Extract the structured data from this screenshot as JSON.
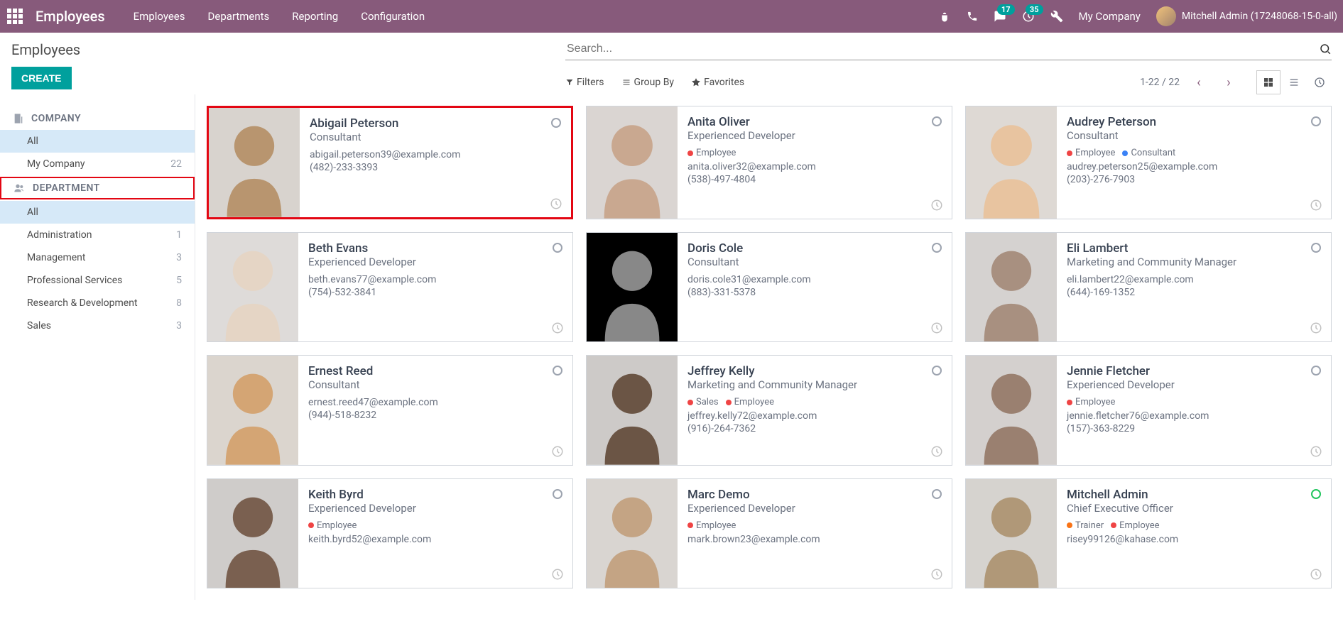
{
  "nav": {
    "brand": "Employees",
    "menu": [
      "Employees",
      "Departments",
      "Reporting",
      "Configuration"
    ],
    "messaging_badge": "17",
    "activity_badge": "35",
    "company": "My Company",
    "user": "Mitchell Admin (17248068-15-0-all)"
  },
  "header": {
    "title": "Employees",
    "create": "CREATE",
    "search_placeholder": "Search...",
    "filters": "Filters",
    "groupby": "Group By",
    "favorites": "Favorites",
    "pager": "1-22 / 22"
  },
  "sidebar": {
    "company_header": "COMPANY",
    "company_items": [
      {
        "label": "All",
        "count": "",
        "active": true
      },
      {
        "label": "My Company",
        "count": "22",
        "active": false
      }
    ],
    "dept_header": "DEPARTMENT",
    "dept_items": [
      {
        "label": "All",
        "count": "",
        "active": true
      },
      {
        "label": "Administration",
        "count": "1",
        "active": false
      },
      {
        "label": "Management",
        "count": "3",
        "active": false
      },
      {
        "label": "Professional Services",
        "count": "5",
        "active": false
      },
      {
        "label": "Research & Development",
        "count": "8",
        "active": false
      },
      {
        "label": "Sales",
        "count": "3",
        "active": false
      }
    ]
  },
  "employees": [
    {
      "name": "Abigail Peterson",
      "title": "Consultant",
      "tags": [],
      "email": "abigail.peterson39@example.com",
      "phone": "(482)-233-3393",
      "highlight": true,
      "status": ""
    },
    {
      "name": "Anita Oliver",
      "title": "Experienced Developer",
      "tags": [
        {
          "c": "red",
          "t": "Employee"
        }
      ],
      "email": "anita.oliver32@example.com",
      "phone": "(538)-497-4804",
      "highlight": false,
      "status": ""
    },
    {
      "name": "Audrey Peterson",
      "title": "Consultant",
      "tags": [
        {
          "c": "red",
          "t": "Employee"
        },
        {
          "c": "blue",
          "t": "Consultant"
        }
      ],
      "email": "audrey.peterson25@example.com",
      "phone": "(203)-276-7903",
      "highlight": false,
      "status": ""
    },
    {
      "name": "Beth Evans",
      "title": "Experienced Developer",
      "tags": [],
      "email": "beth.evans77@example.com",
      "phone": "(754)-532-3841",
      "highlight": false,
      "status": ""
    },
    {
      "name": "Doris Cole",
      "title": "Consultant",
      "tags": [],
      "email": "doris.cole31@example.com",
      "phone": "(883)-331-5378",
      "highlight": false,
      "status": ""
    },
    {
      "name": "Eli Lambert",
      "title": "Marketing and Community Manager",
      "tags": [],
      "email": "eli.lambert22@example.com",
      "phone": "(644)-169-1352",
      "highlight": false,
      "status": ""
    },
    {
      "name": "Ernest Reed",
      "title": "Consultant",
      "tags": [],
      "email": "ernest.reed47@example.com",
      "phone": "(944)-518-8232",
      "highlight": false,
      "status": ""
    },
    {
      "name": "Jeffrey Kelly",
      "title": "Marketing and Community Manager",
      "tags": [
        {
          "c": "red",
          "t": "Sales"
        },
        {
          "c": "red",
          "t": "Employee"
        }
      ],
      "email": "jeffrey.kelly72@example.com",
      "phone": "(916)-264-7362",
      "highlight": false,
      "status": ""
    },
    {
      "name": "Jennie Fletcher",
      "title": "Experienced Developer",
      "tags": [
        {
          "c": "red",
          "t": "Employee"
        }
      ],
      "email": "jennie.fletcher76@example.com",
      "phone": "(157)-363-8229",
      "highlight": false,
      "status": ""
    },
    {
      "name": "Keith Byrd",
      "title": "Experienced Developer",
      "tags": [
        {
          "c": "red",
          "t": "Employee"
        }
      ],
      "email": "keith.byrd52@example.com",
      "phone": "",
      "highlight": false,
      "status": ""
    },
    {
      "name": "Marc Demo",
      "title": "Experienced Developer",
      "tags": [
        {
          "c": "red",
          "t": "Employee"
        }
      ],
      "email": "mark.brown23@example.com",
      "phone": "",
      "highlight": false,
      "status": ""
    },
    {
      "name": "Mitchell Admin",
      "title": "Chief Executive Officer",
      "tags": [
        {
          "c": "orange",
          "t": "Trainer"
        },
        {
          "c": "red",
          "t": "Employee"
        }
      ],
      "email": "risey99126@kahase.com",
      "phone": "",
      "highlight": false,
      "status": "green"
    }
  ],
  "avatar_colors": [
    "#b8956f",
    "#c9a890",
    "#e8c4a0",
    "#e5d5c5",
    "#888",
    "#a89080",
    "#d4a574",
    "#6b5545",
    "#9a8070",
    "#7a6050",
    "#c4a484",
    "#b09878"
  ]
}
